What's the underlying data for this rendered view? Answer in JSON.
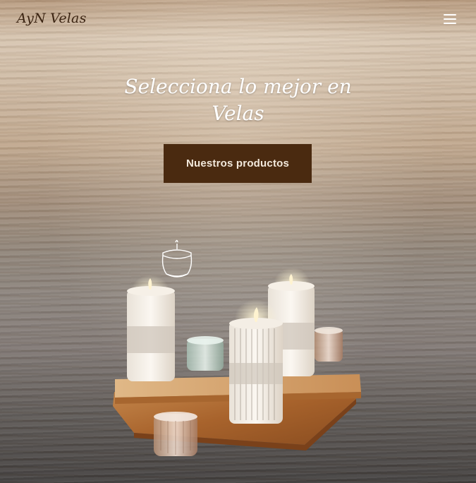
{
  "brand": {
    "name": "AyN Velas"
  },
  "nav": {
    "menu_icon": "hamburger-menu-icon"
  },
  "hero": {
    "headline_line1": "Selecciona lo mejor en",
    "headline_line2": "Velas",
    "cta_label": "Nuestros productos"
  },
  "colors": {
    "cta_bg": "#4a2a10",
    "cta_text": "#f3e9dc",
    "headline": "#ffffff",
    "logo": "#3b2412"
  },
  "icons": [
    "hamburger-menu-icon",
    "candle-jar-icon"
  ]
}
